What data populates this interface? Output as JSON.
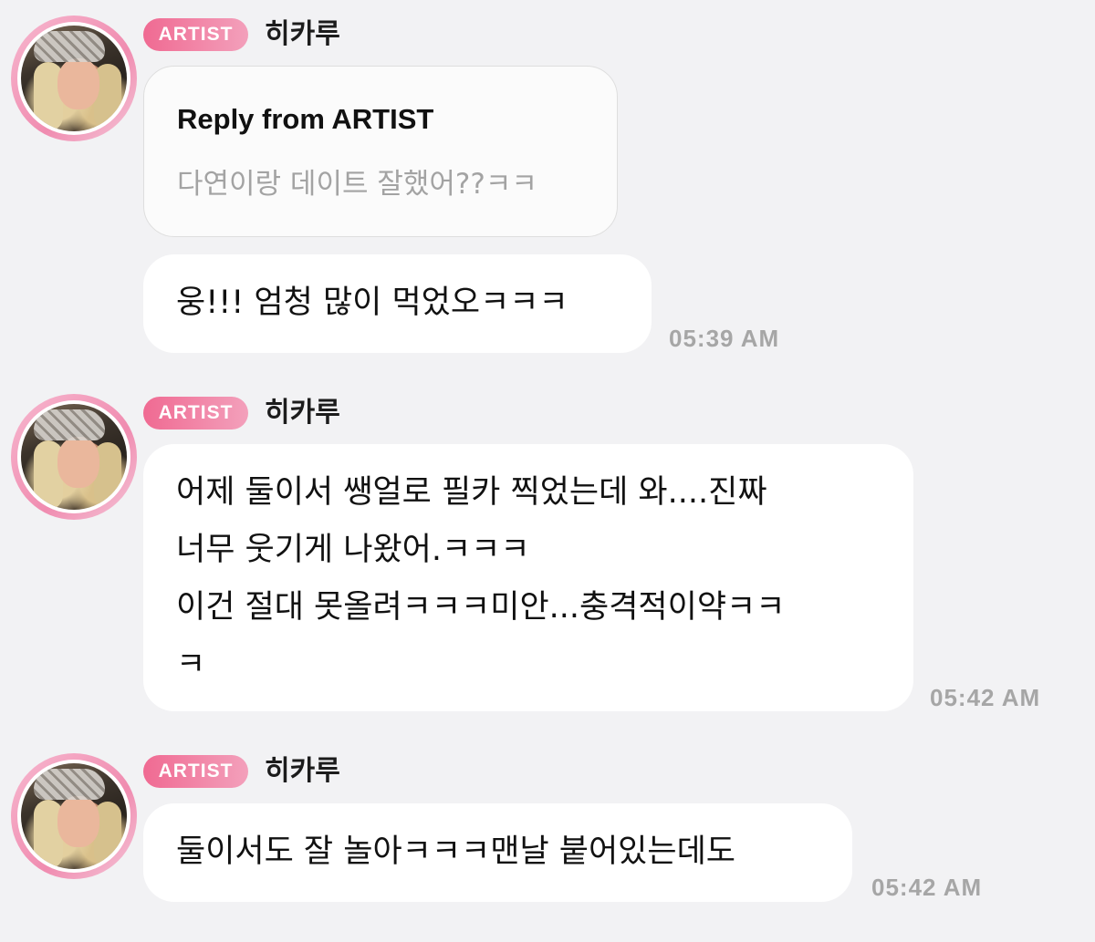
{
  "messages": [
    {
      "badge": "ARTIST",
      "username": "히카루",
      "reply": {
        "title": "Reply from ARTIST",
        "quote": "다연이랑 데이트 잘했어??ㅋㅋ"
      },
      "text": "웅!!! 엄청 많이 먹었오ㅋㅋㅋ",
      "time": "05:39 AM"
    },
    {
      "badge": "ARTIST",
      "username": "히카루",
      "lines": [
        "어제 둘이서 쌩얼로 필카 찍었는데 와....진짜",
        "너무 웃기게 나왔어.ㅋㅋㅋ",
        "이건 절대 못올려ㅋㅋㅋ미안...충격적이약ㅋㅋ",
        "ㅋ"
      ],
      "time": "05:42 AM"
    },
    {
      "badge": "ARTIST",
      "username": "히카루",
      "text": "둘이서도 잘 놀아ㅋㅋㅋ맨날 붙어있는데도",
      "time": "05:42 AM"
    }
  ],
  "colors": {
    "background": "#f2f2f4",
    "badge_start": "#f06a92",
    "badge_end": "#f3a0bb",
    "avatar_ring": "#f08cb0",
    "timestamp": "#a6a6a6"
  },
  "icons": {
    "avatar": "profile-photo"
  }
}
